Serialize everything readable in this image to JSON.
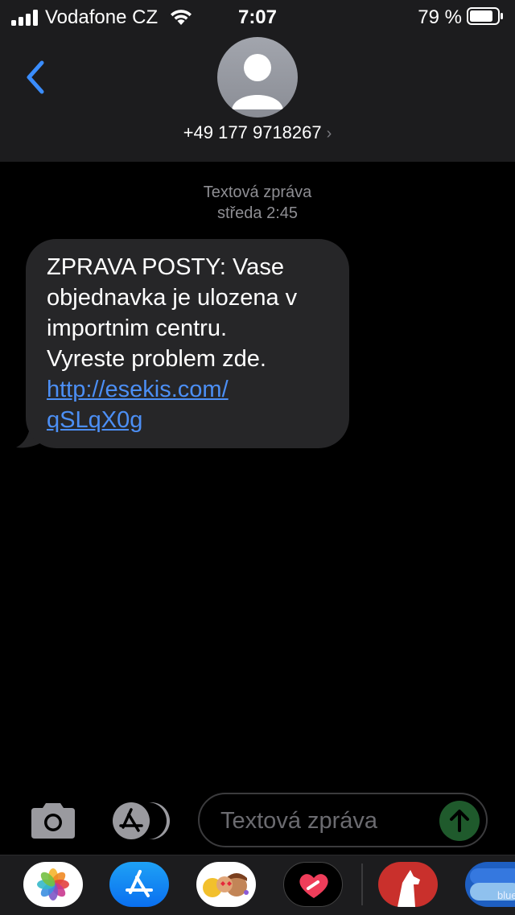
{
  "status_bar": {
    "carrier": "Vodafone CZ",
    "time": "7:07",
    "battery_percent": "79 %"
  },
  "header": {
    "contact": "+49 177 9718267",
    "chevron": "›"
  },
  "conversation": {
    "meta_type": "Textová zpráva",
    "meta_time": "středa 2:45",
    "message": {
      "lines": [
        "ZPRAVA POSTY: Vase",
        "objednavka je ulozena v",
        "importnim centru.",
        "Vyreste problem zde."
      ],
      "link_line1": "http://esekis.com/",
      "link_line2": "qSLqX0g"
    }
  },
  "input": {
    "placeholder": "Textová zpráva"
  },
  "drawer": {
    "apps": [
      "photos-icon",
      "app-store-icon",
      "memoji-icon",
      "digital-touch-icon",
      "dog-app-icon",
      "blue-app-icon"
    ],
    "blue_label": "blue"
  },
  "colors": {
    "link": "#4c8ff5",
    "back_chevron": "#3a8dff",
    "bubble": "#262628",
    "header_bg": "#1c1c1e"
  }
}
